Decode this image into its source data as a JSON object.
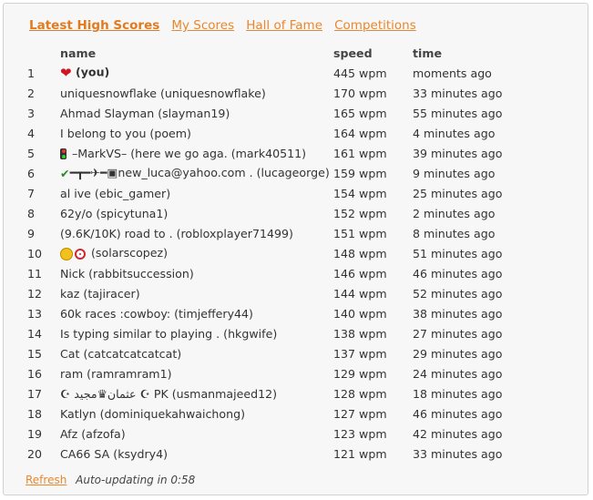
{
  "tabs": [
    "Latest High Scores",
    "My Scores",
    "Hall of Fame",
    "Competitions"
  ],
  "columns": {
    "name": "name",
    "speed": "speed",
    "time": "time"
  },
  "rows": [
    {
      "rank": "1",
      "name": "(you)",
      "speed": "445 wpm",
      "time": "moments ago"
    },
    {
      "rank": "2",
      "name": "uniquesnowflake (uniquesnowflake)",
      "speed": "170 wpm",
      "time": "33 minutes ago"
    },
    {
      "rank": "3",
      "name": "Ahmad Slayman (slayman19)",
      "speed": "165 wpm",
      "time": "55 minutes ago"
    },
    {
      "rank": "4",
      "name": "I belong to you (poem)",
      "speed": "164 wpm",
      "time": "4 minutes ago"
    },
    {
      "rank": "5",
      "name": "–MarkVS– (here we go aga. (mark40511)",
      "speed": "161 wpm",
      "time": "39 minutes ago"
    },
    {
      "rank": "6",
      "name": "━┳━✈━▣new_luca@yahoo.com . (lucageorge)",
      "speed": "159 wpm",
      "time": "9 minutes ago"
    },
    {
      "rank": "7",
      "name": "al ive (ebic_gamer)",
      "speed": "154 wpm",
      "time": "25 minutes ago"
    },
    {
      "rank": "8",
      "name": "62y/o (spicytuna1)",
      "speed": "152 wpm",
      "time": "2 minutes ago"
    },
    {
      "rank": "9",
      "name": "(9.6K/10K) road to . (robloxplayer71499)",
      "speed": "151 wpm",
      "time": "8 minutes ago"
    },
    {
      "rank": "10",
      "name": "(solarscopez)",
      "speed": "148 wpm",
      "time": "51 minutes ago"
    },
    {
      "rank": "11",
      "name": "Nick (rabbitsuccession)",
      "speed": "146 wpm",
      "time": "46 minutes ago"
    },
    {
      "rank": "12",
      "name": "kaz (tajiracer)",
      "speed": "144 wpm",
      "time": "52 minutes ago"
    },
    {
      "rank": "13",
      "name": "60k races :cowboy: (timjeffery44)",
      "speed": "140 wpm",
      "time": "38 minutes ago"
    },
    {
      "rank": "14",
      "name": "Is typing similar to playing . (hkgwife)",
      "speed": "138 wpm",
      "time": "27 minutes ago"
    },
    {
      "rank": "15",
      "name": "Cat (catcatcatcatcat)",
      "speed": "137 wpm",
      "time": "29 minutes ago"
    },
    {
      "rank": "16",
      "name": "ram (ramramram1)",
      "speed": "129 wpm",
      "time": "24 minutes ago"
    },
    {
      "rank": "17",
      "name": "☪ عثمان♛مجيد ☪ PK (usmanmajeed12)",
      "speed": "128 wpm",
      "time": "18 minutes ago"
    },
    {
      "rank": "18",
      "name": "Katlyn (dominiquekahwaichong)",
      "speed": "127 wpm",
      "time": "46 minutes ago"
    },
    {
      "rank": "19",
      "name": "Afz (afzofa)",
      "speed": "123 wpm",
      "time": "42 minutes ago"
    },
    {
      "rank": "20",
      "name": "CA66 SA (ksydry4)",
      "speed": "121 wpm",
      "time": "33 minutes ago"
    }
  ],
  "footer": {
    "refresh": "Refresh",
    "auto_updating": "Auto-updating in 0:58"
  },
  "icons": {
    "row1": "heart-icon",
    "row5": "traffic-light-icon",
    "row6": "check-icon",
    "row10": [
      "sun-icon",
      "target-icon"
    ]
  },
  "colors": {
    "link": "#e8872e",
    "heart": "#d01624",
    "panel_bg": "#f7f7f7"
  }
}
